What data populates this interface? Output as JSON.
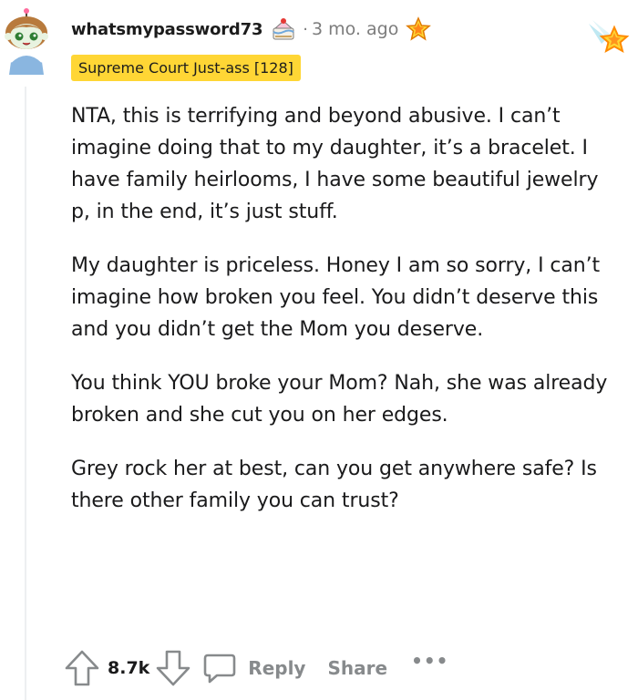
{
  "comment": {
    "username": "whatsmypassword73",
    "separator": "·",
    "timestamp": "3 mo. ago",
    "flair": "Supreme Court Just-ass [128]",
    "icons": {
      "avatar": "snoo-avatar-icon",
      "cake_day": "cake-icon",
      "award": "star-award-icon",
      "menu_award": "shooting-star-award-icon"
    },
    "paragraphs": [
      "NTA, this is terrifying and beyond abusive. I can’t imagine doing that to my daughter, it’s a bracelet. I have family heirlooms, I have some beautiful jewelry p, in the end, it’s just stuff.",
      "My daughter is priceless. Honey I am so sorry, I can’t imagine how broken you feel. You didn’t deserve this and you didn’t get the Mom you deserve.",
      "You think YOU broke your Mom? Nah, she was already broken and she cut you on her edges.",
      "Grey rock her at best, can you get anywhere safe? Is there other family you can trust?"
    ]
  },
  "actions": {
    "vote_count": "8.7k",
    "reply_label": "Reply",
    "share_label": "Share",
    "more_label": "•••"
  },
  "colors": {
    "flair_bg": "#ffd635",
    "muted_text": "#7c7c7c",
    "action_gray": "#878a8c",
    "thread_line": "#edeff1"
  }
}
